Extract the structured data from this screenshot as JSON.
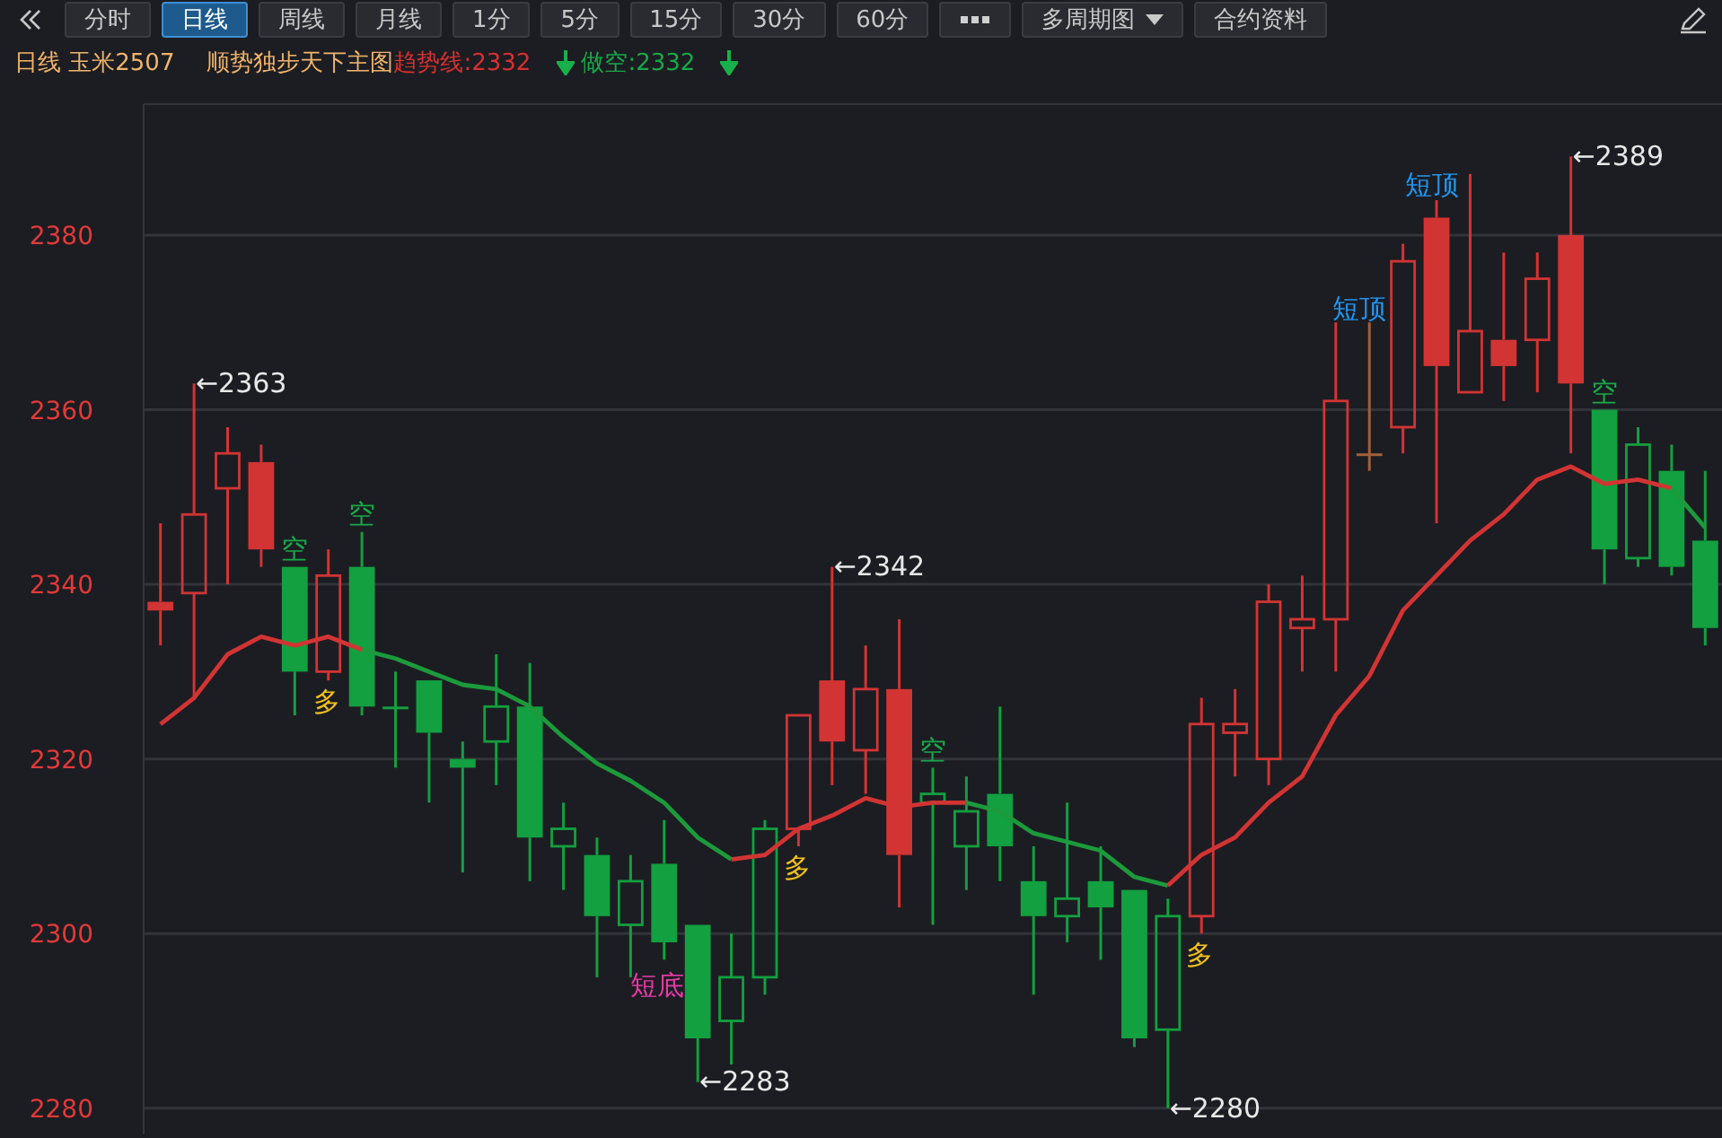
{
  "toolbar": {
    "tabs": [
      {
        "label": "分时",
        "selected": false
      },
      {
        "label": "日线",
        "selected": true
      },
      {
        "label": "周线",
        "selected": false
      },
      {
        "label": "月线",
        "selected": false
      },
      {
        "label": "1分",
        "selected": false
      },
      {
        "label": "5分",
        "selected": false
      },
      {
        "label": "15分",
        "selected": false
      },
      {
        "label": "30分",
        "selected": false
      },
      {
        "label": "60分",
        "selected": false
      }
    ],
    "dropdown": "多周期图",
    "info_button": "合约资料"
  },
  "header": {
    "title": "日线 玉米2507",
    "indicator": "顺势独步天下主图",
    "trend": "趋势线:2332",
    "short": "做空:2332"
  },
  "chart": {
    "chart_data": {
      "type": "candlestick",
      "grid": true,
      "ylim": [
        2277,
        2395
      ],
      "yticks": [
        2280,
        2300,
        2320,
        2340,
        2360,
        2380
      ],
      "categories": [
        null,
        null,
        null,
        null,
        null,
        null,
        null,
        null,
        null,
        null,
        null,
        null,
        null,
        null,
        null,
        null,
        null,
        null,
        null,
        null,
        null,
        null,
        null,
        null,
        null,
        null,
        null,
        null,
        null,
        null,
        null,
        null,
        null,
        null,
        null,
        null,
        null,
        null,
        null,
        null,
        null,
        null,
        null,
        null,
        null,
        null,
        null
      ],
      "series": [
        {
          "color": "#d23434",
          "ohlc": [
            [
              2338,
              2347,
              2333,
              2337
            ],
            [
              2339,
              2363,
              2327,
              2348
            ],
            [
              2351,
              2358,
              2340,
              2355
            ],
            [
              2354,
              2356,
              2342,
              2344
            ],
            null,
            [
              2330,
              2344,
              2329,
              2341
            ],
            null,
            null,
            null,
            null,
            null,
            null,
            null,
            null,
            null,
            null,
            null,
            null,
            null,
            [
              2312,
              2325,
              2310,
              2325
            ],
            [
              2329,
              2342,
              2317,
              2322
            ],
            [
              2321,
              2333,
              2316,
              2328
            ],
            [
              2328,
              2336,
              2303,
              2309
            ],
            null,
            null,
            null,
            null,
            null,
            null,
            null,
            null,
            [
              2302,
              2327,
              2300,
              2324
            ],
            [
              2323,
              2328,
              2318,
              2324
            ],
            [
              2320,
              2340,
              2317,
              2338
            ],
            [
              2335,
              2341,
              2330,
              2336
            ],
            [
              2336,
              2370,
              2330,
              2361
            ],
            null,
            [
              2358,
              2379,
              2355,
              2377
            ],
            [
              2382,
              2384,
              2347,
              2365
            ],
            [
              2362,
              2387,
              2362,
              2369
            ],
            [
              2368,
              2378,
              2361,
              2365
            ],
            [
              2368,
              2378,
              2362,
              2375
            ],
            [
              2380,
              2389,
              2355,
              2363
            ],
            null,
            null,
            null,
            null
          ]
        },
        {
          "color": "#12a040",
          "ohlc": [
            null,
            null,
            null,
            null,
            [
              2342,
              2342,
              2325,
              2330
            ],
            null,
            [
              2342,
              2346,
              2325,
              2326
            ],
            [
              2326,
              2330,
              2319,
              2326
            ],
            [
              2329,
              2329,
              2315,
              2323
            ],
            [
              2320,
              2322,
              2307,
              2319
            ],
            [
              2322,
              2332,
              2317,
              2326
            ],
            [
              2326,
              2331,
              2306,
              2311
            ],
            [
              2310,
              2315,
              2305,
              2312
            ],
            [
              2309,
              2311,
              2295,
              2302
            ],
            [
              2301,
              2309,
              2295,
              2306
            ],
            [
              2308,
              2313,
              2297,
              2299
            ],
            [
              2301,
              2301,
              2283,
              2288
            ],
            [
              2290,
              2300,
              2285,
              2295
            ],
            [
              2295,
              2313,
              2293,
              2312
            ],
            null,
            null,
            null,
            null,
            [
              2315,
              2319,
              2301,
              2316
            ],
            [
              2310,
              2318,
              2305,
              2314
            ],
            [
              2316,
              2326,
              2306,
              2310
            ],
            [
              2306,
              2310,
              2293,
              2302
            ],
            [
              2302,
              2315,
              2299,
              2304
            ],
            [
              2306,
              2310,
              2297,
              2303
            ],
            [
              2305,
              2305,
              2287,
              2288
            ],
            [
              2289,
              2304,
              2280,
              2302
            ],
            null,
            null,
            null,
            null,
            null,
            null,
            null,
            null,
            null,
            null,
            null,
            null,
            [
              2360,
              2360,
              2340,
              2344
            ],
            [
              2343,
              2358,
              2342,
              2356
            ],
            [
              2353,
              2356,
              2341,
              2342
            ],
            [
              2345,
              2353,
              2333,
              2335
            ]
          ]
        },
        {
          "color": "#a0603a",
          "ohlc": [
            null,
            null,
            null,
            null,
            null,
            null,
            null,
            null,
            null,
            null,
            null,
            null,
            null,
            null,
            null,
            null,
            null,
            null,
            null,
            null,
            null,
            null,
            null,
            null,
            null,
            null,
            null,
            null,
            null,
            null,
            null,
            null,
            null,
            null,
            null,
            null,
            [
              2355,
              2370,
              2353,
              2355
            ],
            null,
            null,
            null,
            null,
            null,
            null,
            null,
            null,
            null,
            null
          ]
        },
        {
          "type": "line",
          "color": "#d23434",
          "values": [
            2324,
            2327,
            2332,
            2334,
            2333,
            2334,
            2332.5,
            null,
            null,
            null,
            null,
            null,
            null,
            null,
            null,
            null,
            null,
            null,
            null,
            null,
            null,
            null,
            null,
            null,
            null,
            null,
            null,
            null,
            null,
            null,
            null,
            null,
            null,
            null,
            null,
            null,
            null,
            null,
            null,
            null,
            null,
            null,
            null,
            null,
            null,
            null,
            null
          ]
        },
        {
          "type": "line",
          "color": "#1c9a3c",
          "values": [
            null,
            null,
            null,
            null,
            null,
            null,
            2332.5,
            2331.5,
            2330,
            2328.5,
            2328,
            2326,
            2322.5,
            2319.5,
            2317.5,
            2315,
            2311,
            2308.5,
            null,
            null,
            null,
            null,
            null,
            null,
            null,
            null,
            null,
            null,
            null,
            null,
            null,
            null,
            null,
            null,
            null,
            null,
            null,
            null,
            null,
            null,
            null,
            null,
            null,
            null,
            null,
            null,
            null
          ]
        },
        {
          "type": "line",
          "color": "#d23434",
          "values": [
            null,
            null,
            null,
            null,
            null,
            null,
            null,
            null,
            null,
            null,
            null,
            null,
            null,
            null,
            null,
            null,
            null,
            2308.5,
            2309,
            2312,
            2313.5,
            2315.5,
            2314.5,
            2315,
            2315,
            null,
            null,
            null,
            null,
            null,
            null,
            null,
            null,
            null,
            null,
            null,
            null,
            null,
            null,
            null,
            null,
            null,
            null,
            null,
            null,
            null,
            null
          ]
        },
        {
          "type": "line",
          "color": "#1c9a3c",
          "values": [
            null,
            null,
            null,
            null,
            null,
            null,
            null,
            null,
            null,
            null,
            null,
            null,
            null,
            null,
            null,
            null,
            null,
            null,
            null,
            null,
            null,
            null,
            null,
            null,
            2315,
            2314,
            2311.5,
            2310.5,
            2309.5,
            2306.5,
            2305.5,
            null,
            null,
            null,
            null,
            null,
            null,
            null,
            null,
            null,
            null,
            null,
            null,
            null,
            null,
            null,
            null
          ]
        },
        {
          "type": "line",
          "color": "#d23434",
          "values": [
            null,
            null,
            null,
            null,
            null,
            null,
            null,
            null,
            null,
            null,
            null,
            null,
            null,
            null,
            null,
            null,
            null,
            null,
            null,
            null,
            null,
            null,
            null,
            null,
            null,
            null,
            null,
            null,
            null,
            null,
            2305.5,
            2309,
            2311,
            2315,
            2318,
            2325,
            2329.5,
            2337,
            2341,
            2345,
            2348,
            2352,
            2353.5,
            2351.5,
            2352,
            2351,
            null
          ]
        },
        {
          "type": "line",
          "color": "#1c9a3c",
          "values": [
            null,
            null,
            null,
            null,
            null,
            null,
            null,
            null,
            null,
            null,
            null,
            null,
            null,
            null,
            null,
            null,
            null,
            null,
            null,
            null,
            null,
            null,
            null,
            null,
            null,
            null,
            null,
            null,
            null,
            null,
            null,
            null,
            null,
            null,
            null,
            null,
            null,
            null,
            null,
            null,
            null,
            null,
            null,
            null,
            null,
            2351,
            2346.5
          ]
        }
      ],
      "relative": false
    },
    "labels": [
      {
        "text": "←2363",
        "color": "#e8e8e8"
      },
      {
        "text": "空",
        "color": "#19a84a"
      },
      {
        "text": "多",
        "color": "#f2c21b"
      },
      {
        "text": "空",
        "color": "#19a84a"
      },
      {
        "text": "短底",
        "color": "#e83aa8"
      },
      {
        "text": "←2283",
        "color": "#e8e8e8"
      },
      {
        "text": "多",
        "color": "#f2c21b"
      },
      {
        "text": "←2342",
        "color": "#e8e8e8"
      },
      {
        "text": "空",
        "color": "#19a84a"
      },
      {
        "text": "←2280",
        "color": "#e8e8e8"
      },
      {
        "text": "多",
        "color": "#f2c21b"
      },
      {
        "text": "短顶",
        "color": "#2196f3"
      },
      {
        "text": "短顶",
        "color": "#2196f3"
      },
      {
        "text": "←2389",
        "color": "#e8e8e8"
      },
      {
        "text": "空",
        "color": "#19a84a"
      }
    ]
  }
}
